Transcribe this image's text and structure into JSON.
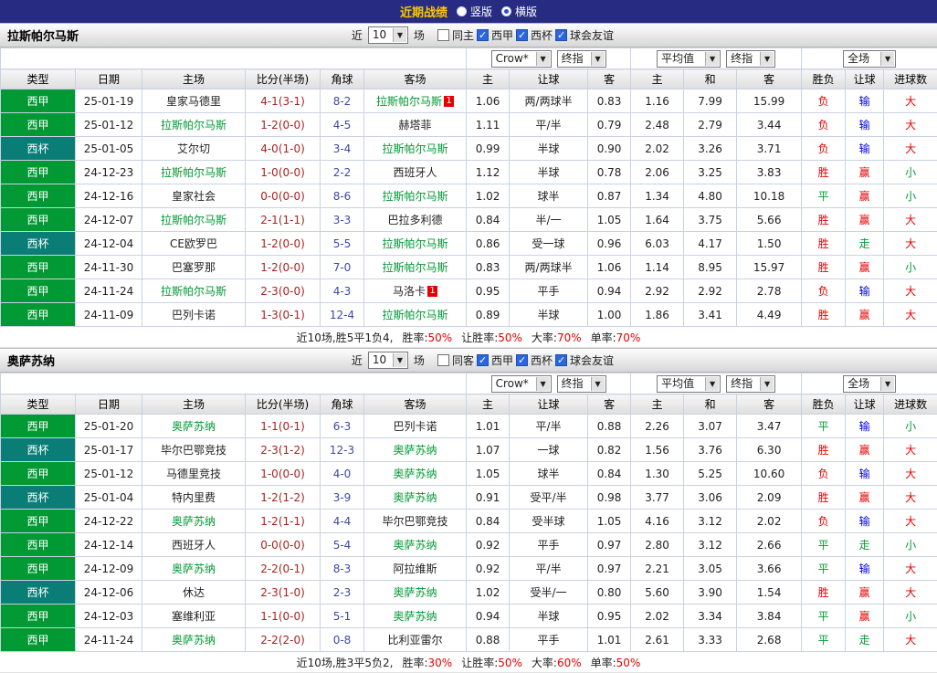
{
  "topbar": {
    "title": "近期战绩",
    "vertical": "竖版",
    "horizontal": "横版",
    "vertical_selected": false,
    "horizontal_selected": true
  },
  "filters": {
    "near": "近",
    "count": "10",
    "games": "场",
    "same_checked": false,
    "leagues": [
      {
        "label": "西甲",
        "checked": true
      },
      {
        "label": "西杯",
        "checked": true
      },
      {
        "label": "球会友谊",
        "checked": true
      }
    ]
  },
  "dropdowns": {
    "bookmaker": "Crow*",
    "final_asian": "终指",
    "average": "平均值",
    "final_euro": "终指",
    "scope": "全场"
  },
  "columns": [
    "类型",
    "日期",
    "主场",
    "比分(半场)",
    "角球",
    "客场",
    "主",
    "让球",
    "客",
    "主",
    "和",
    "客",
    "胜负",
    "让球",
    "进球数"
  ],
  "sections": [
    {
      "team": "拉斯帕尔马斯",
      "same_label": "同主",
      "summary_prefix": "近10场,胜5平1负4,",
      "rates": [
        {
          "label": "胜率:",
          "value": "50%"
        },
        {
          "label": "让胜率:",
          "value": "50%"
        },
        {
          "label": "大率:",
          "value": "70%"
        },
        {
          "label": "单率:",
          "value": "70%"
        }
      ],
      "rows": [
        {
          "league": "西甲",
          "lt": "liga",
          "date": "25-01-19",
          "home": "皇家马德里",
          "hg": false,
          "hb": "",
          "score": "4-1(3-1)",
          "corner": "8-2",
          "away": "拉斯帕尔马斯",
          "ag": true,
          "ab": "1",
          "o1": "1.06",
          "hc": "两/两球半",
          "o2": "0.83",
          "e1": "1.16",
          "e2": "7.99",
          "e3": "15.99",
          "res": "负",
          "resc": "r",
          "let": "输",
          "letc": "b",
          "big": "大",
          "bigc": "r"
        },
        {
          "league": "西甲",
          "lt": "liga",
          "date": "25-01-12",
          "home": "拉斯帕尔马斯",
          "hg": true,
          "hb": "",
          "score": "1-2(0-0)",
          "corner": "4-5",
          "away": "赫塔菲",
          "ag": false,
          "ab": "",
          "o1": "1.11",
          "hc": "平/半",
          "o2": "0.79",
          "e1": "2.48",
          "e2": "2.79",
          "e3": "3.44",
          "res": "负",
          "resc": "r",
          "let": "输",
          "letc": "b",
          "big": "大",
          "bigc": "r"
        },
        {
          "league": "西杯",
          "lt": "cup",
          "date": "25-01-05",
          "home": "艾尔切",
          "hg": false,
          "hb": "",
          "score": "4-0(1-0)",
          "corner": "3-4",
          "away": "拉斯帕尔马斯",
          "ag": true,
          "ab": "",
          "o1": "0.99",
          "hc": "半球",
          "o2": "0.90",
          "e1": "2.02",
          "e2": "3.26",
          "e3": "3.71",
          "res": "负",
          "resc": "r",
          "let": "输",
          "letc": "b",
          "big": "大",
          "bigc": "r"
        },
        {
          "league": "西甲",
          "lt": "liga",
          "date": "24-12-23",
          "home": "拉斯帕尔马斯",
          "hg": true,
          "hb": "",
          "score": "1-0(0-0)",
          "corner": "2-2",
          "away": "西班牙人",
          "ag": false,
          "ab": "",
          "o1": "1.12",
          "hc": "半球",
          "o2": "0.78",
          "e1": "2.06",
          "e2": "3.25",
          "e3": "3.83",
          "res": "胜",
          "resc": "r",
          "let": "赢",
          "letc": "r",
          "big": "小",
          "bigc": "g"
        },
        {
          "league": "西甲",
          "lt": "liga",
          "date": "24-12-16",
          "home": "皇家社会",
          "hg": false,
          "hb": "",
          "score": "0-0(0-0)",
          "corner": "8-6",
          "away": "拉斯帕尔马斯",
          "ag": true,
          "ab": "",
          "o1": "1.02",
          "hc": "球半",
          "o2": "0.87",
          "e1": "1.34",
          "e2": "4.80",
          "e3": "10.18",
          "res": "平",
          "resc": "g",
          "let": "赢",
          "letc": "r",
          "big": "小",
          "bigc": "g"
        },
        {
          "league": "西甲",
          "lt": "liga",
          "date": "24-12-07",
          "home": "拉斯帕尔马斯",
          "hg": true,
          "hb": "",
          "score": "2-1(1-1)",
          "corner": "3-3",
          "away": "巴拉多利德",
          "ag": false,
          "ab": "",
          "o1": "0.84",
          "hc": "半/一",
          "o2": "1.05",
          "e1": "1.64",
          "e2": "3.75",
          "e3": "5.66",
          "res": "胜",
          "resc": "r",
          "let": "赢",
          "letc": "r",
          "big": "大",
          "bigc": "r"
        },
        {
          "league": "西杯",
          "lt": "cup",
          "date": "24-12-04",
          "home": "CE欧罗巴",
          "hg": false,
          "hb": "",
          "score": "1-2(0-0)",
          "corner": "5-5",
          "away": "拉斯帕尔马斯",
          "ag": true,
          "ab": "",
          "o1": "0.86",
          "hc": "受一球",
          "o2": "0.96",
          "e1": "6.03",
          "e2": "4.17",
          "e3": "1.50",
          "res": "胜",
          "resc": "r",
          "let": "走",
          "letc": "g",
          "big": "大",
          "bigc": "r"
        },
        {
          "league": "西甲",
          "lt": "liga",
          "date": "24-11-30",
          "home": "巴塞罗那",
          "hg": false,
          "hb": "",
          "score": "1-2(0-0)",
          "corner": "7-0",
          "away": "拉斯帕尔马斯",
          "ag": true,
          "ab": "",
          "o1": "0.83",
          "hc": "两/两球半",
          "o2": "1.06",
          "e1": "1.14",
          "e2": "8.95",
          "e3": "15.97",
          "res": "胜",
          "resc": "r",
          "let": "赢",
          "letc": "r",
          "big": "小",
          "bigc": "g"
        },
        {
          "league": "西甲",
          "lt": "liga",
          "date": "24-11-24",
          "home": "拉斯帕尔马斯",
          "hg": true,
          "hb": "",
          "score": "2-3(0-0)",
          "corner": "4-3",
          "away": "马洛卡",
          "ag": false,
          "ab": "1",
          "o1": "0.95",
          "hc": "平手",
          "o2": "0.94",
          "e1": "2.92",
          "e2": "2.92",
          "e3": "2.78",
          "res": "负",
          "resc": "r",
          "let": "输",
          "letc": "b",
          "big": "大",
          "bigc": "r"
        },
        {
          "league": "西甲",
          "lt": "liga",
          "date": "24-11-09",
          "home": "巴列卡诺",
          "hg": false,
          "hb": "",
          "score": "1-3(0-1)",
          "corner": "12-4",
          "away": "拉斯帕尔马斯",
          "ag": true,
          "ab": "",
          "o1": "0.89",
          "hc": "半球",
          "o2": "1.00",
          "e1": "1.86",
          "e2": "3.41",
          "e3": "4.49",
          "res": "胜",
          "resc": "r",
          "let": "赢",
          "letc": "r",
          "big": "大",
          "bigc": "r"
        }
      ]
    },
    {
      "team": "奥萨苏纳",
      "same_label": "同客",
      "summary_prefix": "近10场,胜3平5负2,",
      "rates": [
        {
          "label": "胜率:",
          "value": "30%"
        },
        {
          "label": "让胜率:",
          "value": "50%"
        },
        {
          "label": "大率:",
          "value": "60%"
        },
        {
          "label": "单率:",
          "value": "50%"
        }
      ],
      "rows": [
        {
          "league": "西甲",
          "lt": "liga",
          "date": "25-01-20",
          "home": "奥萨苏纳",
          "hg": true,
          "hb": "",
          "score": "1-1(0-1)",
          "corner": "6-3",
          "away": "巴列卡诺",
          "ag": false,
          "ab": "",
          "o1": "1.01",
          "hc": "平/半",
          "o2": "0.88",
          "e1": "2.26",
          "e2": "3.07",
          "e3": "3.47",
          "res": "平",
          "resc": "g",
          "let": "输",
          "letc": "b",
          "big": "小",
          "bigc": "g"
        },
        {
          "league": "西杯",
          "lt": "cup",
          "date": "25-01-17",
          "home": "毕尔巴鄂竞技",
          "hg": false,
          "hb": "",
          "score": "2-3(1-2)",
          "corner": "12-3",
          "away": "奥萨苏纳",
          "ag": true,
          "ab": "",
          "o1": "1.07",
          "hc": "一球",
          "o2": "0.82",
          "e1": "1.56",
          "e2": "3.76",
          "e3": "6.30",
          "res": "胜",
          "resc": "r",
          "let": "赢",
          "letc": "r",
          "big": "大",
          "bigc": "r"
        },
        {
          "league": "西甲",
          "lt": "liga",
          "date": "25-01-12",
          "home": "马德里竞技",
          "hg": false,
          "hb": "",
          "score": "1-0(0-0)",
          "corner": "4-0",
          "away": "奥萨苏纳",
          "ag": true,
          "ab": "",
          "o1": "1.05",
          "hc": "球半",
          "o2": "0.84",
          "e1": "1.30",
          "e2": "5.25",
          "e3": "10.60",
          "res": "负",
          "resc": "r",
          "let": "输",
          "letc": "b",
          "big": "大",
          "bigc": "r"
        },
        {
          "league": "西杯",
          "lt": "cup",
          "date": "25-01-04",
          "home": "特内里费",
          "hg": false,
          "hb": "",
          "score": "1-2(1-2)",
          "corner": "3-9",
          "away": "奥萨苏纳",
          "ag": true,
          "ab": "",
          "o1": "0.91",
          "hc": "受平/半",
          "o2": "0.98",
          "e1": "3.77",
          "e2": "3.06",
          "e3": "2.09",
          "res": "胜",
          "resc": "r",
          "let": "赢",
          "letc": "r",
          "big": "大",
          "bigc": "r"
        },
        {
          "league": "西甲",
          "lt": "liga",
          "date": "24-12-22",
          "home": "奥萨苏纳",
          "hg": true,
          "hb": "",
          "score": "1-2(1-1)",
          "corner": "4-4",
          "away": "毕尔巴鄂竞技",
          "ag": false,
          "ab": "",
          "o1": "0.84",
          "hc": "受半球",
          "o2": "1.05",
          "e1": "4.16",
          "e2": "3.12",
          "e3": "2.02",
          "res": "负",
          "resc": "r",
          "let": "输",
          "letc": "b",
          "big": "大",
          "bigc": "r"
        },
        {
          "league": "西甲",
          "lt": "liga",
          "date": "24-12-14",
          "home": "西班牙人",
          "hg": false,
          "hb": "",
          "score": "0-0(0-0)",
          "corner": "5-4",
          "away": "奥萨苏纳",
          "ag": true,
          "ab": "",
          "o1": "0.92",
          "hc": "平手",
          "o2": "0.97",
          "e1": "2.80",
          "e2": "3.12",
          "e3": "2.66",
          "res": "平",
          "resc": "g",
          "let": "走",
          "letc": "g",
          "big": "小",
          "bigc": "g"
        },
        {
          "league": "西甲",
          "lt": "liga",
          "date": "24-12-09",
          "home": "奥萨苏纳",
          "hg": true,
          "hb": "",
          "score": "2-2(0-1)",
          "corner": "8-3",
          "away": "阿拉维斯",
          "ag": false,
          "ab": "",
          "o1": "0.92",
          "hc": "平/半",
          "o2": "0.97",
          "e1": "2.21",
          "e2": "3.05",
          "e3": "3.66",
          "res": "平",
          "resc": "g",
          "let": "输",
          "letc": "b",
          "big": "大",
          "bigc": "r"
        },
        {
          "league": "西杯",
          "lt": "cup",
          "date": "24-12-06",
          "home": "休达",
          "hg": false,
          "hb": "",
          "score": "2-3(1-0)",
          "corner": "2-3",
          "away": "奥萨苏纳",
          "ag": true,
          "ab": "",
          "o1": "1.02",
          "hc": "受半/一",
          "o2": "0.80",
          "e1": "5.60",
          "e2": "3.90",
          "e3": "1.54",
          "res": "胜",
          "resc": "r",
          "let": "赢",
          "letc": "r",
          "big": "大",
          "bigc": "r"
        },
        {
          "league": "西甲",
          "lt": "liga",
          "date": "24-12-03",
          "home": "塞维利亚",
          "hg": false,
          "hb": "",
          "score": "1-1(0-0)",
          "corner": "5-1",
          "away": "奥萨苏纳",
          "ag": true,
          "ab": "",
          "o1": "0.94",
          "hc": "半球",
          "o2": "0.95",
          "e1": "2.02",
          "e2": "3.34",
          "e3": "3.84",
          "res": "平",
          "resc": "g",
          "let": "赢",
          "letc": "r",
          "big": "小",
          "bigc": "g"
        },
        {
          "league": "西甲",
          "lt": "liga",
          "date": "24-11-24",
          "home": "奥萨苏纳",
          "hg": true,
          "hb": "",
          "score": "2-2(2-0)",
          "corner": "0-8",
          "away": "比利亚雷尔",
          "ag": false,
          "ab": "",
          "o1": "0.88",
          "hc": "平手",
          "o2": "1.01",
          "e1": "2.61",
          "e2": "3.33",
          "e3": "2.68",
          "res": "平",
          "resc": "g",
          "let": "走",
          "letc": "g",
          "big": "大",
          "bigc": "r"
        }
      ]
    }
  ]
}
